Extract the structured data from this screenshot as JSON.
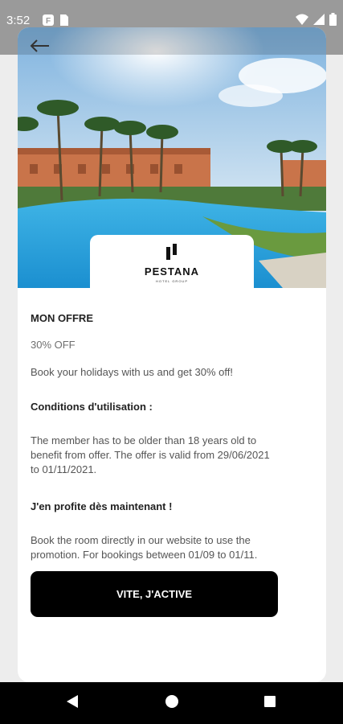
{
  "status_bar": {
    "time": "3:52"
  },
  "logo": {
    "name": "PESTANA",
    "subtitle": "HOTEL GROUP"
  },
  "offer": {
    "title": "MON OFFRE",
    "discount": "30% OFF",
    "description": "Book your holidays with us and get 30% off!",
    "conditions_title": "Conditions d'utilisation :",
    "conditions_text": "The member has to be older than 18 years old to benefit from offer. The offer is valid from 29/06/2021 to 01/11/2021.",
    "redeem_title": "J'en profite dès maintenant !",
    "redeem_text": "Book the room directly in our website to use the promotion. For bookings between 01/09 to 01/11."
  },
  "cta": {
    "label": "VITE, J'ACTIVE"
  },
  "colors": {
    "cta_bg": "#000000",
    "card_bg": "#ffffff",
    "status_bar": "#9a9a9a"
  }
}
